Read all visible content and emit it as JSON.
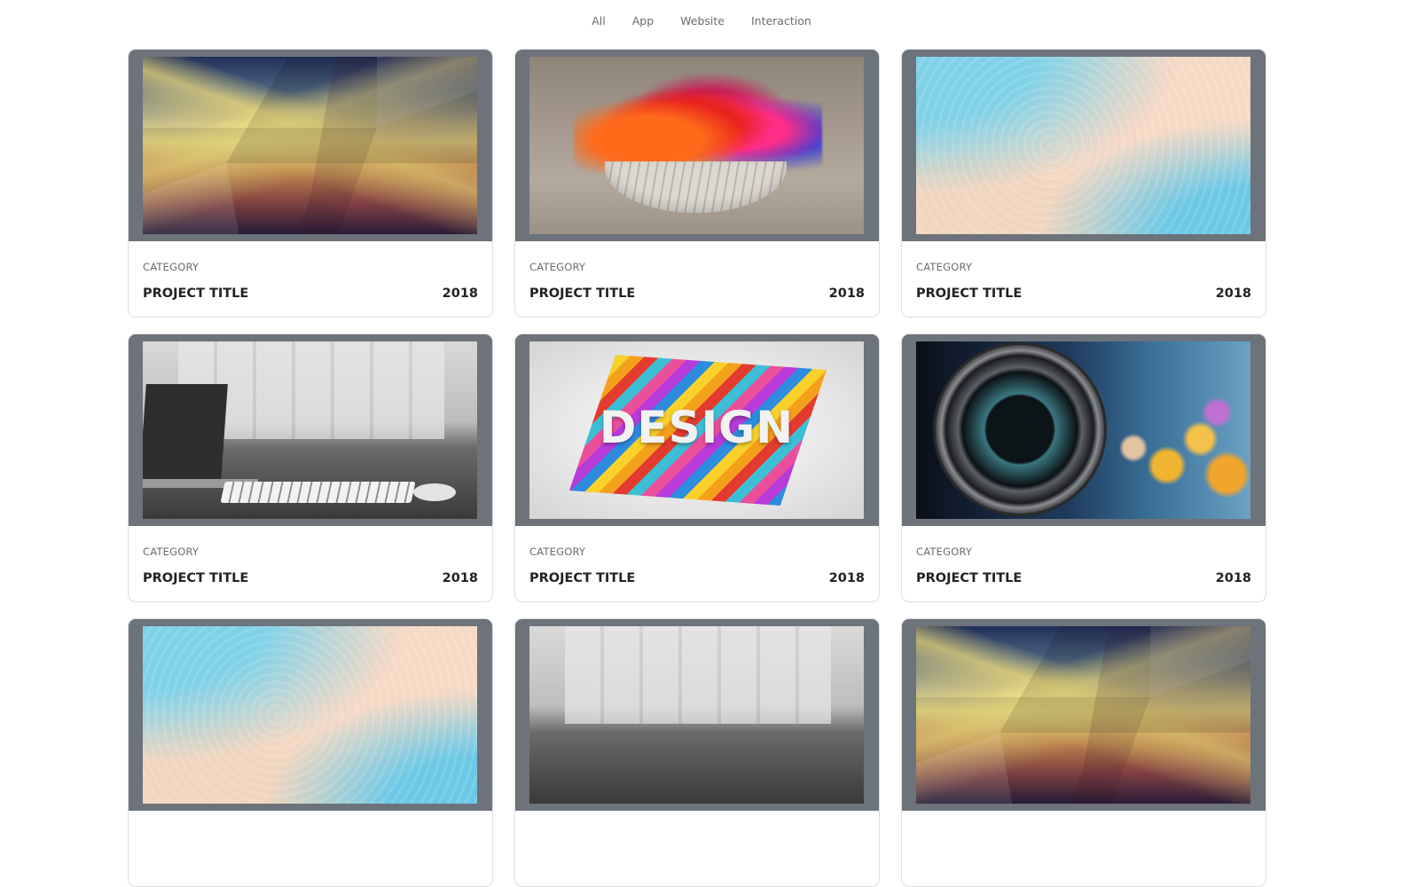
{
  "filters": [
    "All",
    "App",
    "Website",
    "Interaction"
  ],
  "cards": [
    {
      "category": "CATEGORY",
      "title": "PROJECT TITLE",
      "year": "2018",
      "image": "low-poly-gradient"
    },
    {
      "category": "CATEGORY",
      "title": "PROJECT TITLE",
      "year": "2018",
      "image": "brain-paint-splash"
    },
    {
      "category": "CATEGORY",
      "title": "PROJECT TITLE",
      "year": "2018",
      "image": "pastel-texture"
    },
    {
      "category": "CATEGORY",
      "title": "PROJECT TITLE",
      "year": "2018",
      "image": "desk-keyboard"
    },
    {
      "category": "CATEGORY",
      "title": "PROJECT TITLE",
      "year": "2018",
      "image": "design-stripes",
      "image_text": "DESIGN"
    },
    {
      "category": "CATEGORY",
      "title": "PROJECT TITLE",
      "year": "2018",
      "image": "camera-lens"
    },
    {
      "image": "pastel-texture"
    },
    {
      "image": "desk-keyboard"
    },
    {
      "image": "low-poly-gradient"
    }
  ],
  "colors": {
    "card_media_bg": "#6c737b",
    "text_dark": "#222222",
    "text_muted": "#6c6c6c"
  }
}
